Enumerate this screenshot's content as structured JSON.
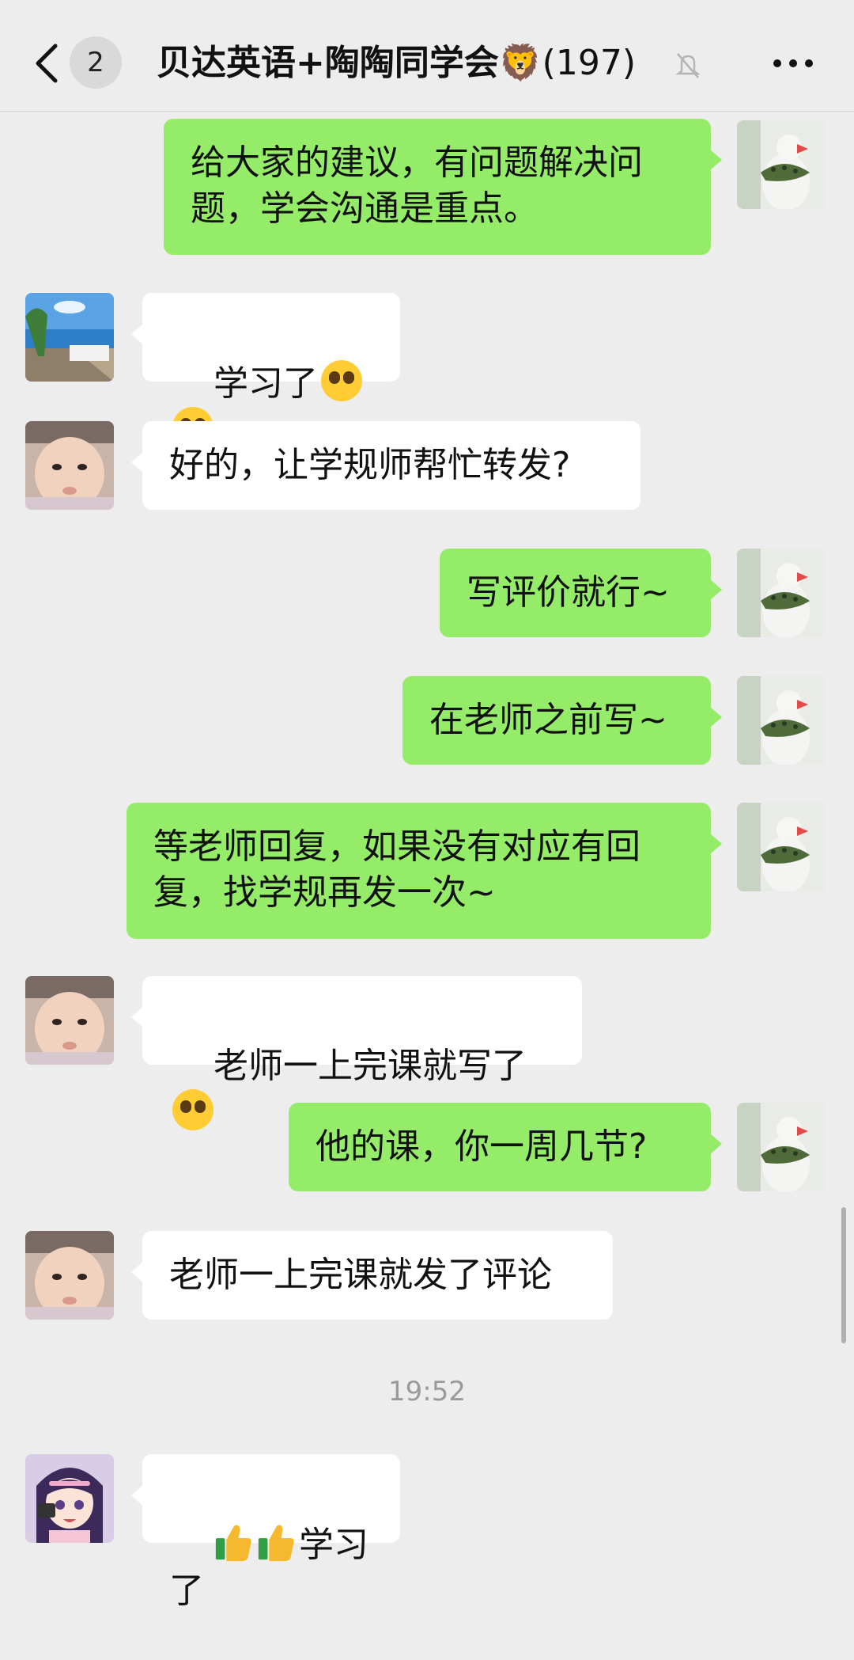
{
  "header": {
    "unread_count": "2",
    "title": "贝达英语+陶陶同学会",
    "title_emoji": "🦁",
    "member_count": "(197)"
  },
  "messages": [
    {
      "side": "out",
      "text": "给大家的建议，有问题解决问\n题，学会沟通是重点。",
      "avatar": "bird-avatar"
    },
    {
      "side": "in",
      "text": "学习了",
      "emoji": "pleading-face x2",
      "avatar": "seaside-avatar"
    },
    {
      "side": "in",
      "text": "好的，让学规师帮忙转发?",
      "avatar": "baby-avatar"
    },
    {
      "side": "out",
      "text": "写评价就行~",
      "avatar": "bird-avatar"
    },
    {
      "side": "out",
      "text": "在老师之前写~",
      "avatar": "bird-avatar"
    },
    {
      "side": "out",
      "text": "等老师回复，如果没有对应有回\n复，找学规再发一次~",
      "avatar": "bird-avatar"
    },
    {
      "side": "in",
      "text": "老师一上完课就写了",
      "emoji": "crying-laughing-face",
      "avatar": "baby-avatar"
    },
    {
      "side": "out",
      "text": "他的课，你一周几节?",
      "avatar": "bird-avatar"
    },
    {
      "side": "in",
      "text": "老师一上完课就发了评论",
      "avatar": "baby-avatar"
    },
    {
      "side": "in",
      "text": "学习了",
      "emoji": "thumbs-up x2",
      "avatar": "anime-girl-avatar"
    }
  ],
  "timestamp": "19:52",
  "colors": {
    "background": "#ededed",
    "outgoing_bubble": "#95ec69",
    "incoming_bubble": "#ffffff"
  }
}
